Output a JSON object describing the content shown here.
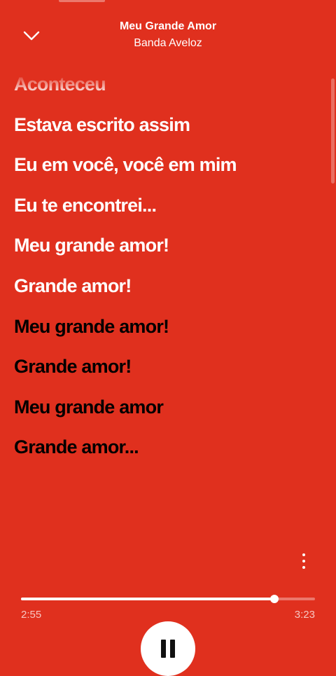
{
  "header": {
    "title": "Meu Grande Amor",
    "artist": "Banda Aveloz"
  },
  "lyrics": {
    "lines": [
      "Aconteceu",
      "Estava escrito assim",
      "Eu em você, você em mim",
      "Eu te encontrei...",
      "Meu grande amor!",
      "Grande amor!",
      "Meu grande amor!",
      "Grande amor!",
      "Meu grande amor",
      "Grande amor..."
    ],
    "active_count": 6
  },
  "playback": {
    "elapsed": "2:55",
    "total": "3:23",
    "progress": 0.862,
    "state": "playing"
  },
  "icons": {
    "collapse": "chevron-down-icon",
    "more": "more-vertical-icon",
    "play_pause": "pause-icon"
  },
  "colors": {
    "background": "#e0301e",
    "lyric_past": "#ffffff",
    "lyric_upcoming": "#000000",
    "accent": "#ffffff"
  }
}
